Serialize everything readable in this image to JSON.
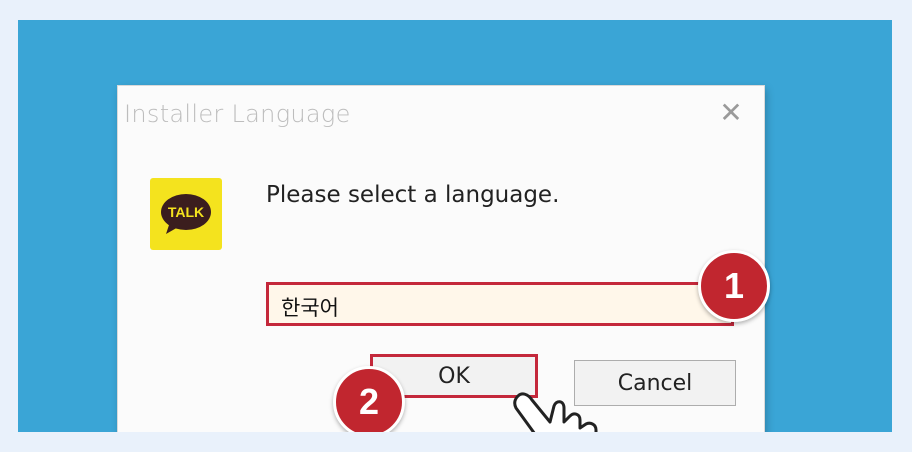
{
  "dialog": {
    "title": "Installer Language",
    "close_icon": "close-icon",
    "logo": {
      "text": "TALK",
      "icon": "kakaotalk-logo",
      "color": "#f4e31e"
    },
    "prompt": "Please select a language.",
    "language_select": {
      "value": "한국어",
      "highlight_color": "#c4283b"
    },
    "ok_label": "OK",
    "cancel_label": "Cancel"
  },
  "annotations": {
    "step_1": "1",
    "step_2": "2",
    "badge_color": "#c1262f",
    "pointer_icon": "hand-pointer-icon"
  },
  "background_color": "#3aa5d6"
}
